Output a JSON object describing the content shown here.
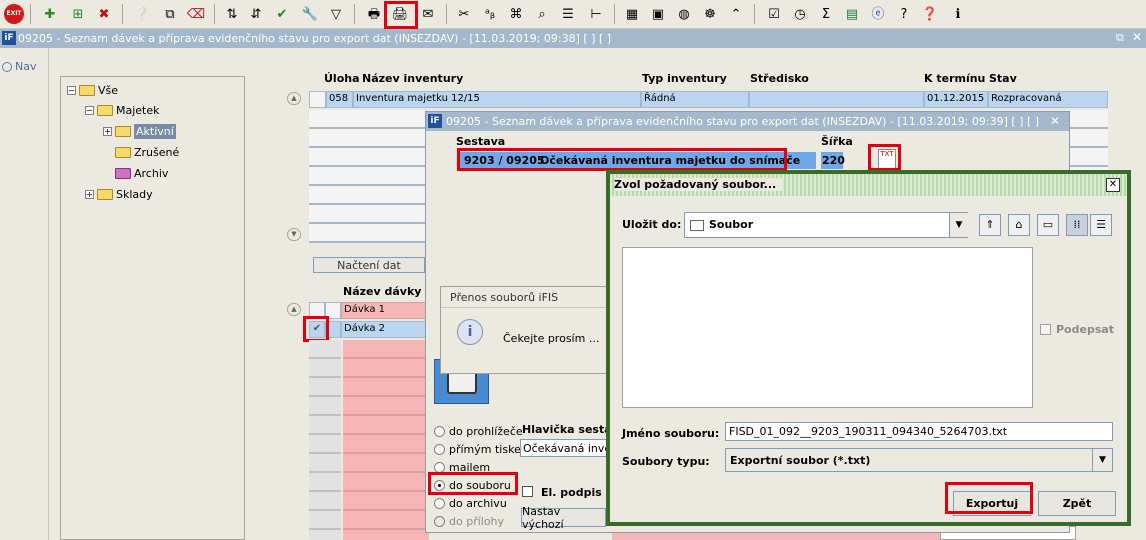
{
  "toolbar": {
    "exit_label": "EXIT"
  },
  "titlebar": {
    "title": "09205 - Seznam dávek a příprava evidenčního stavu pro export dat (INSEZDAV) - [11.03.2019; 09:38]  [ ]  [ ]"
  },
  "nav": {
    "label": "Nav"
  },
  "tree": {
    "root": "Vše",
    "majetek": "Majetek",
    "aktivni": "Aktivní",
    "zrusene": "Zrušené",
    "archiv": "Archiv",
    "sklady": "Sklady"
  },
  "inv_table": {
    "headers": {
      "uloha": "Úloha",
      "nazev": "Název inventury",
      "typ": "Typ inventury",
      "stredisko": "Středisko",
      "termin": "K termínu",
      "stav": "Stav"
    },
    "row": {
      "uloha": "058",
      "nazev": "Inventura majetku 12/15",
      "typ": "Řádná",
      "stredisko": "",
      "termin": "01.12.2015",
      "stav": "Rozpracovaná"
    }
  },
  "nacteni_button": "Načtení dat",
  "davky": {
    "header": "Název dávky",
    "rows": [
      "Dávka 1",
      "Dávka 2"
    ]
  },
  "sestava_dialog": {
    "title": "09205 - Seznam dávek a příprava evidenčního stavu pro export dat (INSEZDAV) - [11.03.2019; 09:39]  [ ]  [ ]",
    "col_sestava": "Sestava",
    "col_sirka": "Šířka",
    "sestava_code": "9203 / 09205",
    "sestava_name": "Očekávaná inventura majetku do snímače",
    "sirka": "220",
    "radio_prohlizece": "do prohlížeče",
    "radio_tisk": "přímým tiskem",
    "radio_mail": "mailem",
    "radio_soubor": "do souboru",
    "radio_archiv": "do archivu",
    "radio_prilohy": "do přílohy",
    "hlavicka_label": "Hlavička sestav",
    "hlavicka_value": "Očekávaná inven",
    "el_podpis": "El. podpis",
    "nastav_button": "Nastav výchozí"
  },
  "prenos": {
    "title": "Přenos souborů iFIS",
    "message": "Čekejte prosím ..."
  },
  "file_dialog": {
    "title": "Zvol požadovaný soubor...",
    "ulozit_label": "Uložit do:",
    "ulozit_value": "Soubor",
    "podepsat": "Podepsat",
    "jmeno_label": "Jméno souboru:",
    "jmeno_value": "FISD_01_092__9203_190311_094340_5264703.txt",
    "typ_label": "Soubory typu:",
    "typ_value": "Exportní soubor (*.txt)",
    "export_button": "Exportuj",
    "zpet_button": "Zpět"
  },
  "colors": {
    "highlight": "#e00010",
    "accent_green": "#3a6b2a",
    "selected_row": "#b9d5f0",
    "pink_row": "#f6b6b6",
    "titlebar": "#a3b8cc"
  }
}
